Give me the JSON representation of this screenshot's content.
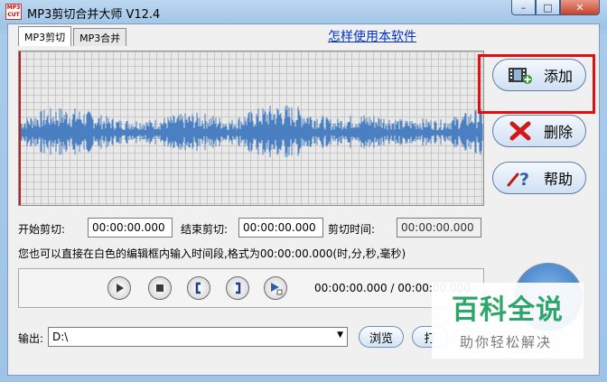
{
  "window": {
    "title": "MP3剪切合并大师 V12.4",
    "icon_text": "MP3\nCUT",
    "controls": {
      "minimize": "–",
      "maximize": "□",
      "close": "✕"
    }
  },
  "tabs": [
    {
      "label": "MP3剪切",
      "active": true
    },
    {
      "label": "MP3合并",
      "active": false
    }
  ],
  "help_link": "怎样使用本软件",
  "side_buttons": {
    "add": {
      "label": "添加",
      "icon": "film-add-icon"
    },
    "delete": {
      "label": "删除",
      "icon": "red-x-icon"
    },
    "help": {
      "label": "帮助",
      "icon": "help-question-icon"
    }
  },
  "cut": {
    "start_label": "开始剪切:",
    "start_value": "00:00:00.000",
    "end_label": "结束剪切:",
    "end_value": "00:00:00.000",
    "duration_label": "剪切时间:",
    "duration_value": "00:00:00.000",
    "hint": "您也可以直接在白色的编辑框内输入时间段,格式为00:00:00.000(时,分,秒,毫秒)"
  },
  "player": {
    "buttons": [
      "play-icon",
      "stop-icon",
      "mark-start-icon",
      "mark-end-icon",
      "play-selection-icon"
    ],
    "time_readout": "00:00:00.000 / 00:00:00.000"
  },
  "output": {
    "label": "输出:",
    "path": "D:\\",
    "browse_label": "浏览",
    "open_label": "打"
  },
  "watermark": {
    "title": "百科全说",
    "subtitle": "助你轻松解决"
  },
  "colors": {
    "waveform": "#4a7fc1",
    "highlight": "#dd1111",
    "link": "#0033cc"
  }
}
